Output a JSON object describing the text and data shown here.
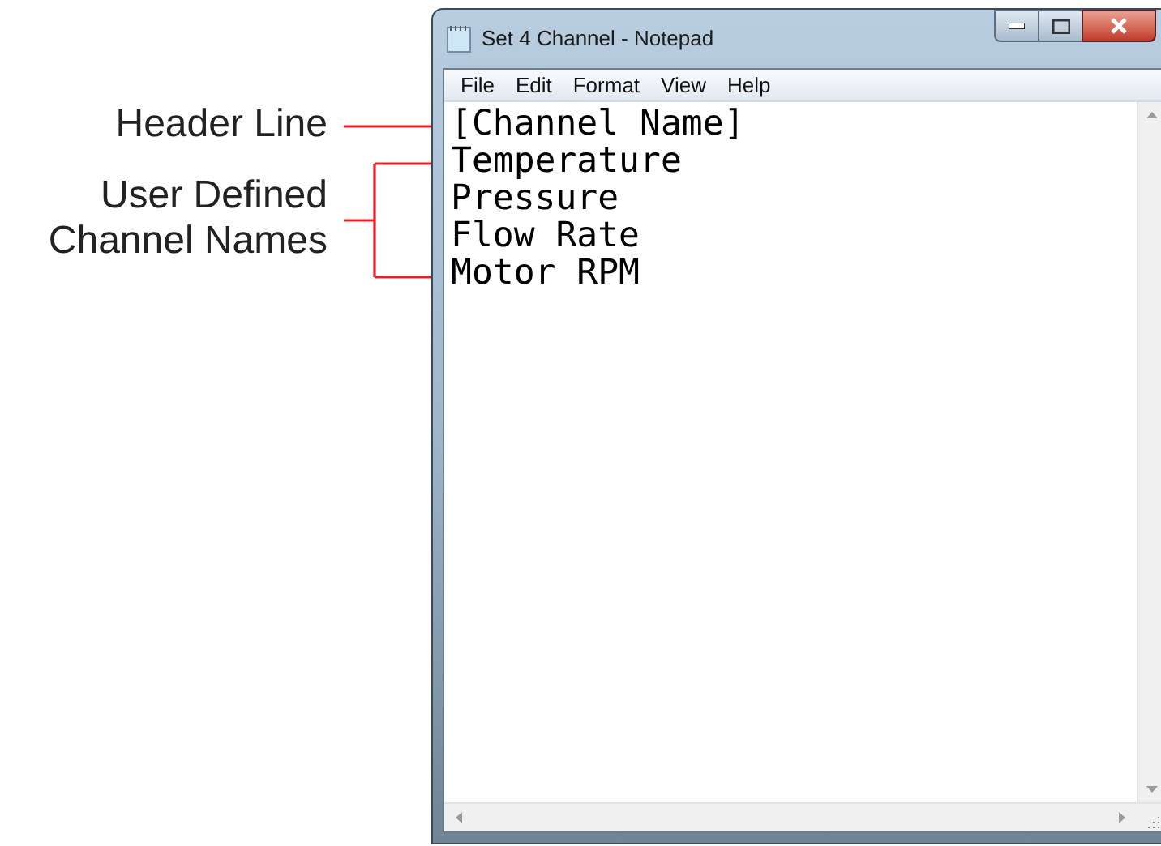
{
  "window": {
    "title": "Set 4 Channel - Notepad"
  },
  "menu": [
    "File",
    "Edit",
    "Format",
    "View",
    "Help"
  ],
  "lines": [
    "[Channel Name]",
    "Temperature",
    "Pressure",
    "Flow Rate",
    "Motor RPM"
  ],
  "annotations": [
    {
      "kind": "single",
      "label": "Header Line"
    },
    {
      "kind": "bracket",
      "label": "User Defined Channel Names"
    }
  ]
}
